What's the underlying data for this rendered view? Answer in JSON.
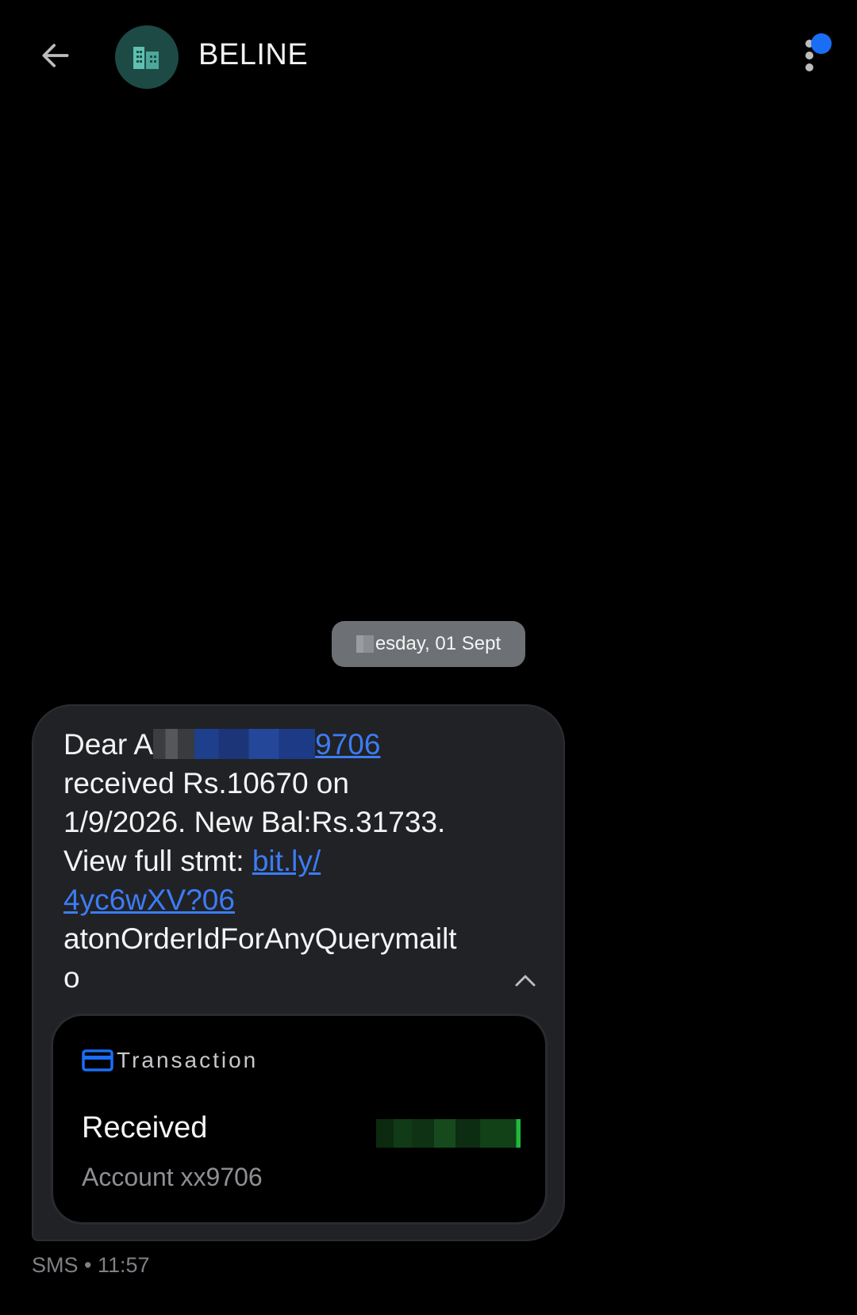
{
  "header": {
    "contact_name": "BELINE",
    "back_icon": "arrow-left-icon",
    "avatar_icon": "building-icon",
    "menu_icon": "more-vert-icon",
    "notification_color": "#1a6ef5"
  },
  "conversation": {
    "date_chip": "esday, 01 Sept",
    "message": {
      "line1_prefix": "Dear A",
      "line1_link_suffix": "9706",
      "line2": "received Rs.10670 on",
      "line3": "1/9/2026. New Bal:Rs.31733.",
      "line4_prefix": "View full stmt: ",
      "line4_link": "bit.ly/",
      "line5_link": "4yc6wXV?06",
      "line6": "atonOrderIdForAnyQuerymailt",
      "line7": "o",
      "link_color": "#3c7cf5"
    },
    "transaction_card": {
      "icon": "credit-card-icon",
      "label": "Transaction",
      "status": "Received",
      "account": "Account xx9706"
    },
    "meta": "SMS • 11:57"
  }
}
